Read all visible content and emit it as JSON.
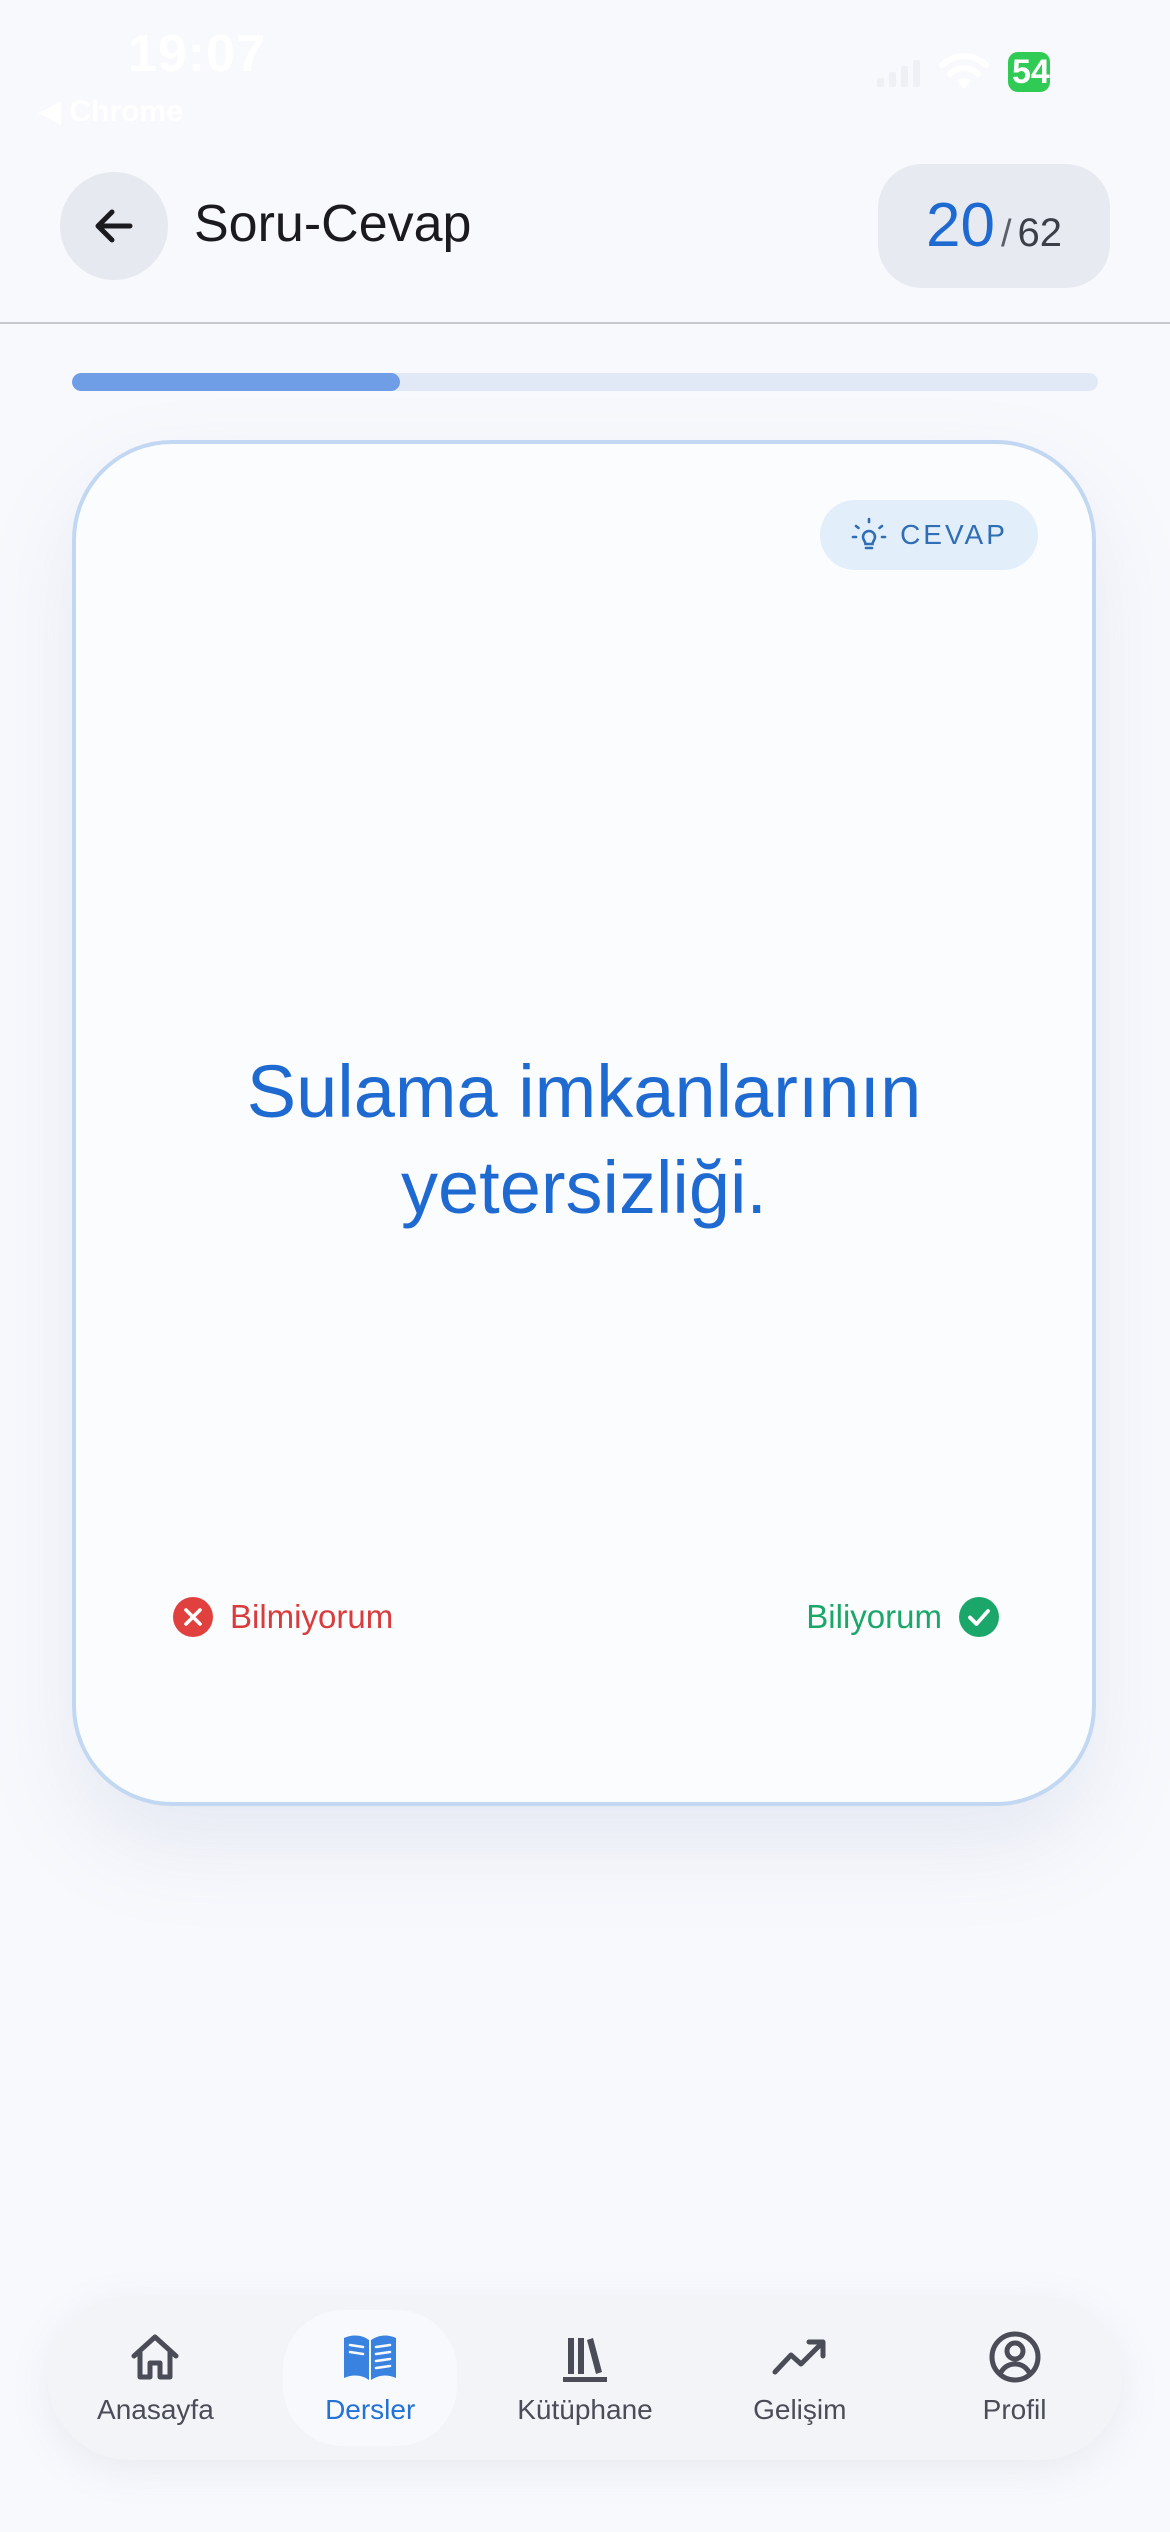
{
  "status_bar": {
    "time": "19:07",
    "back_app": "◀ Chrome",
    "battery": "54"
  },
  "header": {
    "title": "Soru-Cevap",
    "counter_current": "20",
    "counter_separator": "/",
    "counter_total": "62",
    "back_icon": "arrow-left-icon"
  },
  "progress": {
    "value": 0.32,
    "color": "#6f9de6"
  },
  "card": {
    "chip_label": "CEVAP",
    "chip_icon": "lightbulb-icon",
    "answer": "Sulama imkanlarının yetersizliği.",
    "unknown_label": "Bilmiyorum",
    "known_label": "Biliyorum",
    "accent_color": "#1f6ad1"
  },
  "bottom_nav": {
    "items": [
      {
        "label": "Anasayfa",
        "icon": "home-icon",
        "active": false
      },
      {
        "label": "Dersler",
        "icon": "book-open-icon",
        "active": true
      },
      {
        "label": "Kütüphane",
        "icon": "library-icon",
        "active": false
      },
      {
        "label": "Gelişim",
        "icon": "trending-up-icon",
        "active": false
      },
      {
        "label": "Profil",
        "icon": "user-circle-icon",
        "active": false
      }
    ]
  }
}
